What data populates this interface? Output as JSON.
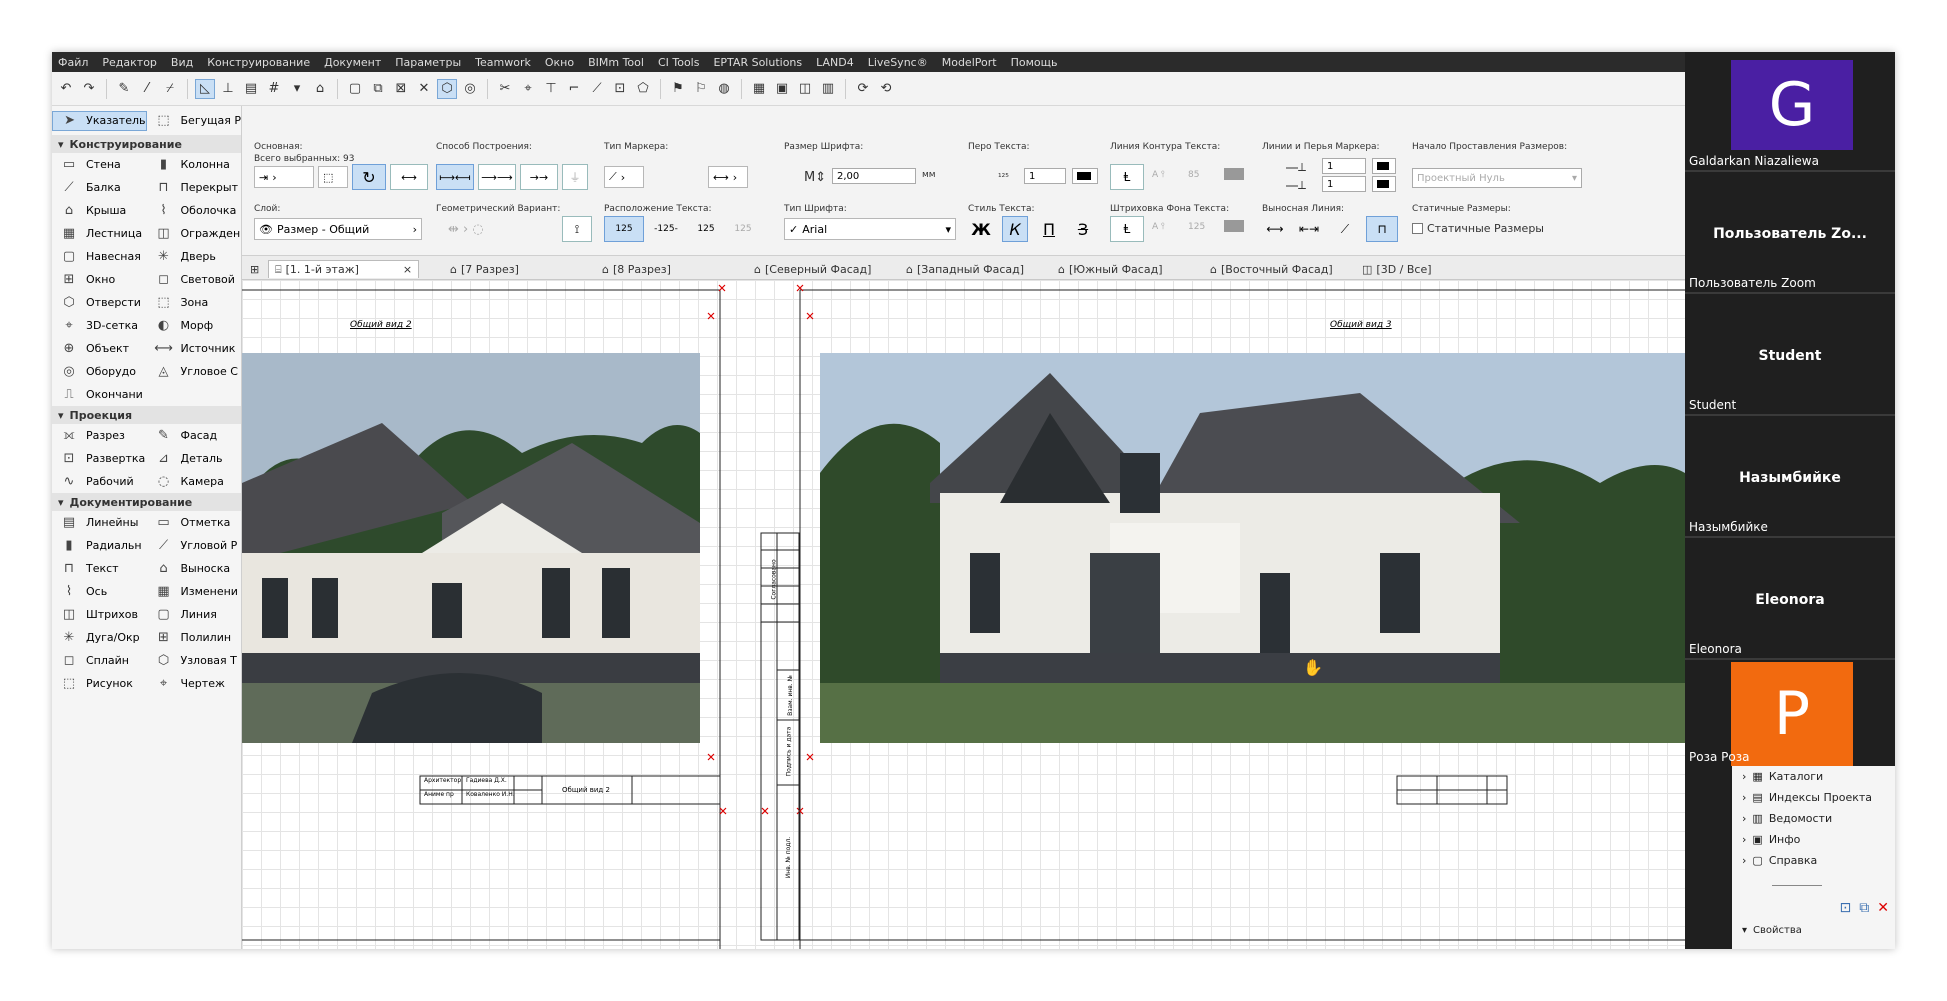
{
  "menu": [
    "Файл",
    "Редактор",
    "Вид",
    "Конструирование",
    "Документ",
    "Параметры",
    "Teamwork",
    "Окно",
    "BIMm Tool",
    "CI Tools",
    "EPTAR Solutions",
    "LAND4",
    "LiveSync®",
    "ModelPort",
    "Помощь"
  ],
  "infobox": {
    "basic_label": "Основная:",
    "selected_count": "Всего выбранных: 93",
    "construction_method_label": "Способ Построения:",
    "marker_type_label": "Тип Маркера:",
    "font_size_label": "Размер Шрифта:",
    "font_size_value": "2,00",
    "font_size_unit": "мм",
    "text_pen_label": "Перо Текста:",
    "text_pen_value": "1",
    "text_contour_label": "Линия Контура Текста:",
    "text_contour_value": "85",
    "marker_pens_label": "Линии и Перья Маркера:",
    "marker_pen_1": "1",
    "marker_pen_2": "1",
    "dimension_origin_label": "Начало Проставления Размеров:",
    "dimension_origin_value": "Проектный Нуль",
    "layer_label": "Слой:",
    "layer_value": "Размер - Общий",
    "geometric_variant_label": "Геометрический Вариант:",
    "text_position_label": "Расположение Текста:",
    "text_pos_1": "125",
    "text_pos_2": "-125-",
    "text_pos_3": "125",
    "text_pos_4": "125",
    "font_type_label": "Тип Шрифта:",
    "font_value": "Arial",
    "text_style_label": "Стиль Текста:",
    "style_bold": "Ж",
    "style_italic": "К",
    "style_underline": "П",
    "style_strike": "З",
    "text_bg_hatch_label": "Штриховка Фона Текста:",
    "text_bg_value": "125",
    "extension_lines_label": "Выносная Линия:",
    "static_dims_label": "Статичные Размеры:",
    "static_dims_checkbox": "Статичные Размеры"
  },
  "toolbox": {
    "pointer": "Указатель",
    "marquee": "Бегущая Р",
    "sections": [
      {
        "title": "Конструирование",
        "rows": [
          [
            "Стена",
            "Колонна"
          ],
          [
            "Балка",
            "Перекрыт"
          ],
          [
            "Крыша",
            "Оболочка"
          ],
          [
            "Лестница",
            "Огражден"
          ],
          [
            "Навесная",
            "Дверь"
          ],
          [
            "Окно",
            "Световой"
          ],
          [
            "Отверсти",
            "Зона"
          ],
          [
            "3D-сетка",
            "Морф"
          ],
          [
            "Объект",
            "Источник"
          ],
          [
            "Оборудо",
            "Угловое С"
          ],
          [
            "Окончани",
            ""
          ]
        ]
      },
      {
        "title": "Проекция",
        "rows": [
          [
            "Разрез",
            "Фасад"
          ],
          [
            "Развертка",
            "Деталь"
          ],
          [
            "Рабочий",
            "Камера"
          ]
        ]
      },
      {
        "title": "Документирование",
        "rows": [
          [
            "Линейны",
            "Отметка"
          ],
          [
            "Радиальн",
            "Угловой Р"
          ],
          [
            "Текст",
            "Выноска"
          ],
          [
            "Ось",
            "Изменени"
          ],
          [
            "Штрихов",
            "Линия"
          ],
          [
            "Дуга/Окр",
            "Полилин"
          ],
          [
            "Сплайн",
            "Узловая Т"
          ],
          [
            "Рисунок",
            "Чертеж"
          ]
        ]
      }
    ]
  },
  "tabs": [
    "[1. 1-й этаж]",
    "[7 Разрез]",
    "[8 Разрез]",
    "[Северный Фасад]",
    "[Западный Фасад]",
    "[Южный Фасад]",
    "[Восточный Фасад]",
    "[3D / Все]"
  ],
  "canvas": {
    "left_view_title": "Общий вид 2",
    "right_view_title": "Общий вид 3",
    "stamp": {
      "role_1": "Архитектор",
      "name_1": "Гадиева Д.Х.",
      "role_2": "Аниме пр",
      "name_2": "Коваленко И.Н.",
      "sheet_title": "Общий вид 2"
    },
    "vertical_labels": [
      "Согласовано",
      "Взам. инв. №",
      "Подпись и дата",
      "Инв. № подл."
    ]
  },
  "participants": [
    {
      "name": "Galdarkan Niazaliewa",
      "initial": "G",
      "color": "#4a1fa3"
    },
    {
      "name": "Пользователь Zoom",
      "display": "Пользователь Zo..."
    },
    {
      "name": "Student",
      "display": "Student"
    },
    {
      "name": "Назымбийке",
      "display": "Назымбийке"
    },
    {
      "name": "Eleonora",
      "display": "Eleonora"
    },
    {
      "name": "Роза Роза",
      "initial": "P",
      "color": "#f26a0f"
    }
  ],
  "navigator": [
    "Каталоги",
    "Индексы Проекта",
    "Ведомости",
    "Инфо",
    "Справка"
  ],
  "navigator_footer": "Свойства"
}
